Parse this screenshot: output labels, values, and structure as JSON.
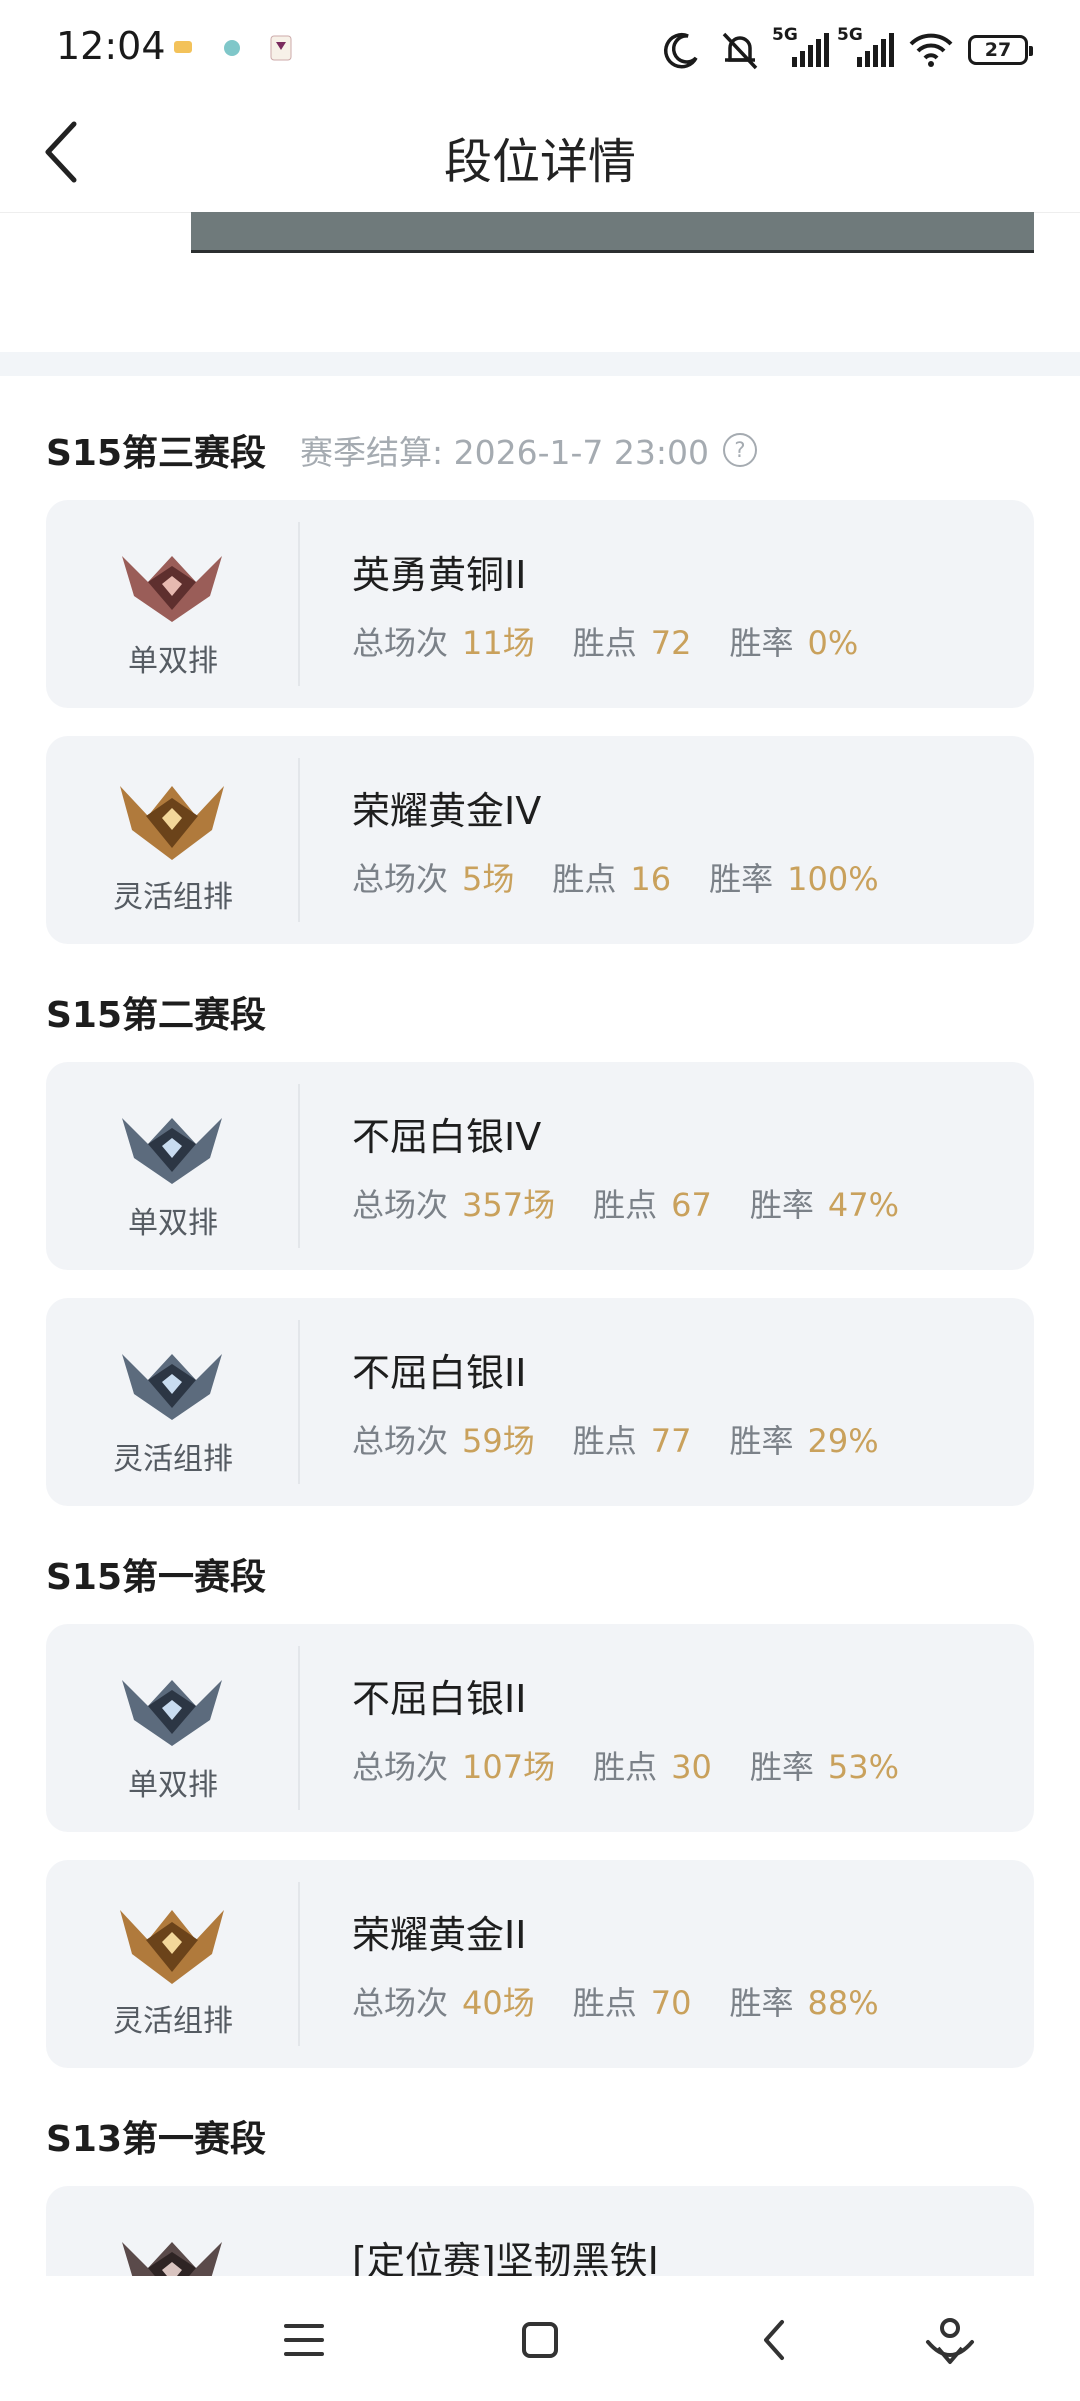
{
  "status_bar": {
    "time": "12:04",
    "signal1_label": "5G",
    "signal2_label": "5G",
    "battery": "27"
  },
  "header": {
    "title": "段位详情"
  },
  "colors": {
    "accent_value": "#c9a15c",
    "card_bg": "#f2f4f7",
    "muted_text": "#a5abb1"
  },
  "seasons": [
    {
      "title": "S15第三赛段",
      "settle_text": "赛季结算: 2026-1-7 23:00",
      "help_icon": "?",
      "cards": [
        {
          "queue": "单双排",
          "rank": "英勇黄铜II",
          "emblem": "bronze-emblem-icon",
          "games_label": "总场次",
          "games": "11场",
          "points_label": "胜点",
          "points": "72",
          "rate_label": "胜率",
          "rate": "0%"
        },
        {
          "queue": "灵活组排",
          "rank": "荣耀黄金IV",
          "emblem": "gold-emblem-icon",
          "games_label": "总场次",
          "games": "5场",
          "points_label": "胜点",
          "points": "16",
          "rate_label": "胜率",
          "rate": "100%"
        }
      ]
    },
    {
      "title": "S15第二赛段",
      "cards": [
        {
          "queue": "单双排",
          "rank": "不屈白银IV",
          "emblem": "silver-emblem-icon",
          "games_label": "总场次",
          "games": "357场",
          "points_label": "胜点",
          "points": "67",
          "rate_label": "胜率",
          "rate": "47%"
        },
        {
          "queue": "灵活组排",
          "rank": "不屈白银II",
          "emblem": "silver-emblem-icon",
          "games_label": "总场次",
          "games": "59场",
          "points_label": "胜点",
          "points": "77",
          "rate_label": "胜率",
          "rate": "29%"
        }
      ]
    },
    {
      "title": "S15第一赛段",
      "cards": [
        {
          "queue": "单双排",
          "rank": "不屈白银II",
          "emblem": "silver-emblem-icon",
          "games_label": "总场次",
          "games": "107场",
          "points_label": "胜点",
          "points": "30",
          "rate_label": "胜率",
          "rate": "53%"
        },
        {
          "queue": "灵活组排",
          "rank": "荣耀黄金II",
          "emblem": "gold-emblem-icon",
          "games_label": "总场次",
          "games": "40场",
          "points_label": "胜点",
          "points": "70",
          "rate_label": "胜率",
          "rate": "88%"
        }
      ]
    },
    {
      "title": "S13第一赛段",
      "cards": [
        {
          "rank": "[定位赛]坚韧黑铁I",
          "emblem": "iron-emblem-icon"
        }
      ]
    }
  ]
}
